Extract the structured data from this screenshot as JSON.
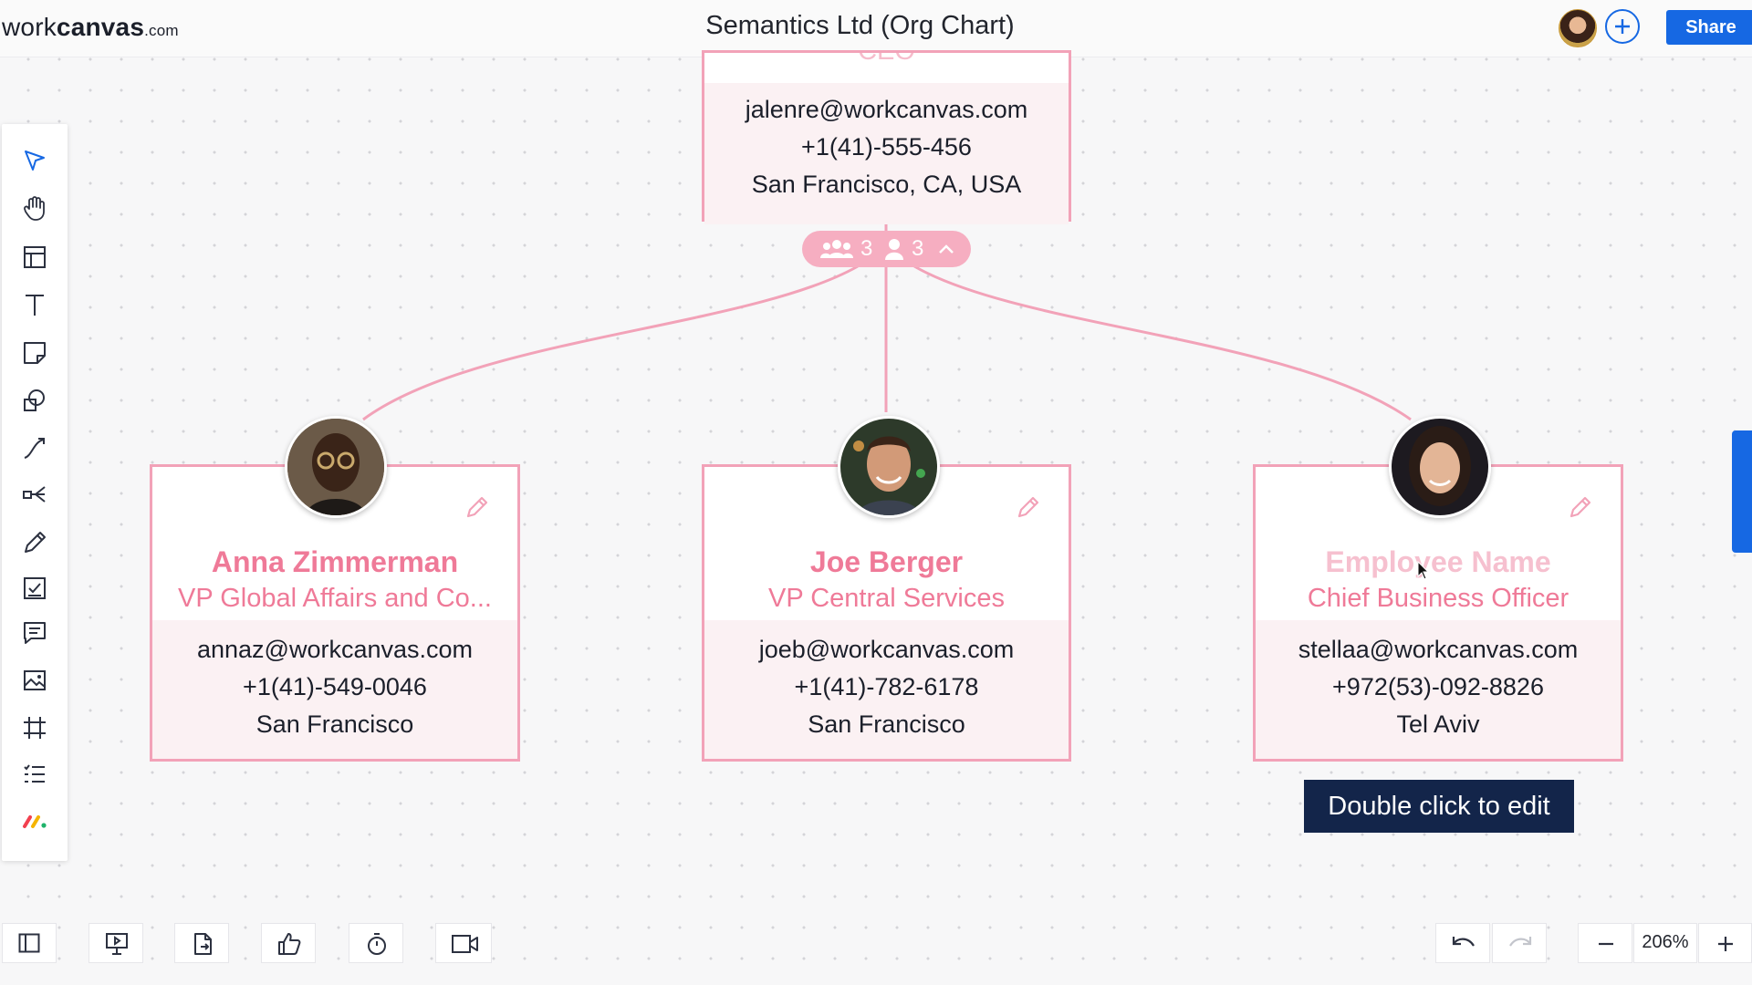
{
  "app": {
    "logo_regular": "work",
    "logo_bold": "canvas",
    "logo_suffix": ".com",
    "document_title": "Semantics Ltd (Org Chart)",
    "share_label": "Share"
  },
  "top_card": {
    "cut_off_text": "CEO",
    "email": "jalenre@workcanvas.com",
    "phone": "+1(41)-555-456",
    "location": "San Francisco, CA, USA"
  },
  "team_pill": {
    "group_count": "3",
    "person_count": "3"
  },
  "employees": [
    {
      "name": "Anna Zimmerman",
      "role": "VP Global Affairs and Co...",
      "email": "annaz@workcanvas.com",
      "phone": "+1(41)-549-0046",
      "location": "San Francisco"
    },
    {
      "name": "Joe Berger",
      "role": "VP Central Services",
      "email": "joeb@workcanvas.com",
      "phone": "+1(41)-782-6178",
      "location": "San Francisco"
    },
    {
      "name": "Employee Name",
      "role": "Chief Business Officer",
      "email": "stellaa@workcanvas.com",
      "phone": "+972(53)-092-8826",
      "location": "Tel Aviv"
    }
  ],
  "tooltip": "Double click to edit",
  "zoom": {
    "value": "206%"
  },
  "colors": {
    "accent": "#1668e3",
    "card_border": "#f2a2b8",
    "name_pink": "#ef7a98",
    "tooltip_bg": "#13254a"
  },
  "left_toolbar_icons": [
    "select-arrow-icon",
    "hand-icon",
    "layout-icon",
    "text-icon",
    "sticky-note-icon",
    "shapes-icon",
    "connector-line-icon",
    "mind-map-icon",
    "pen-icon",
    "checklist-icon",
    "comment-icon",
    "image-icon",
    "frame-icon",
    "list-icon",
    "monday-logo-icon"
  ]
}
